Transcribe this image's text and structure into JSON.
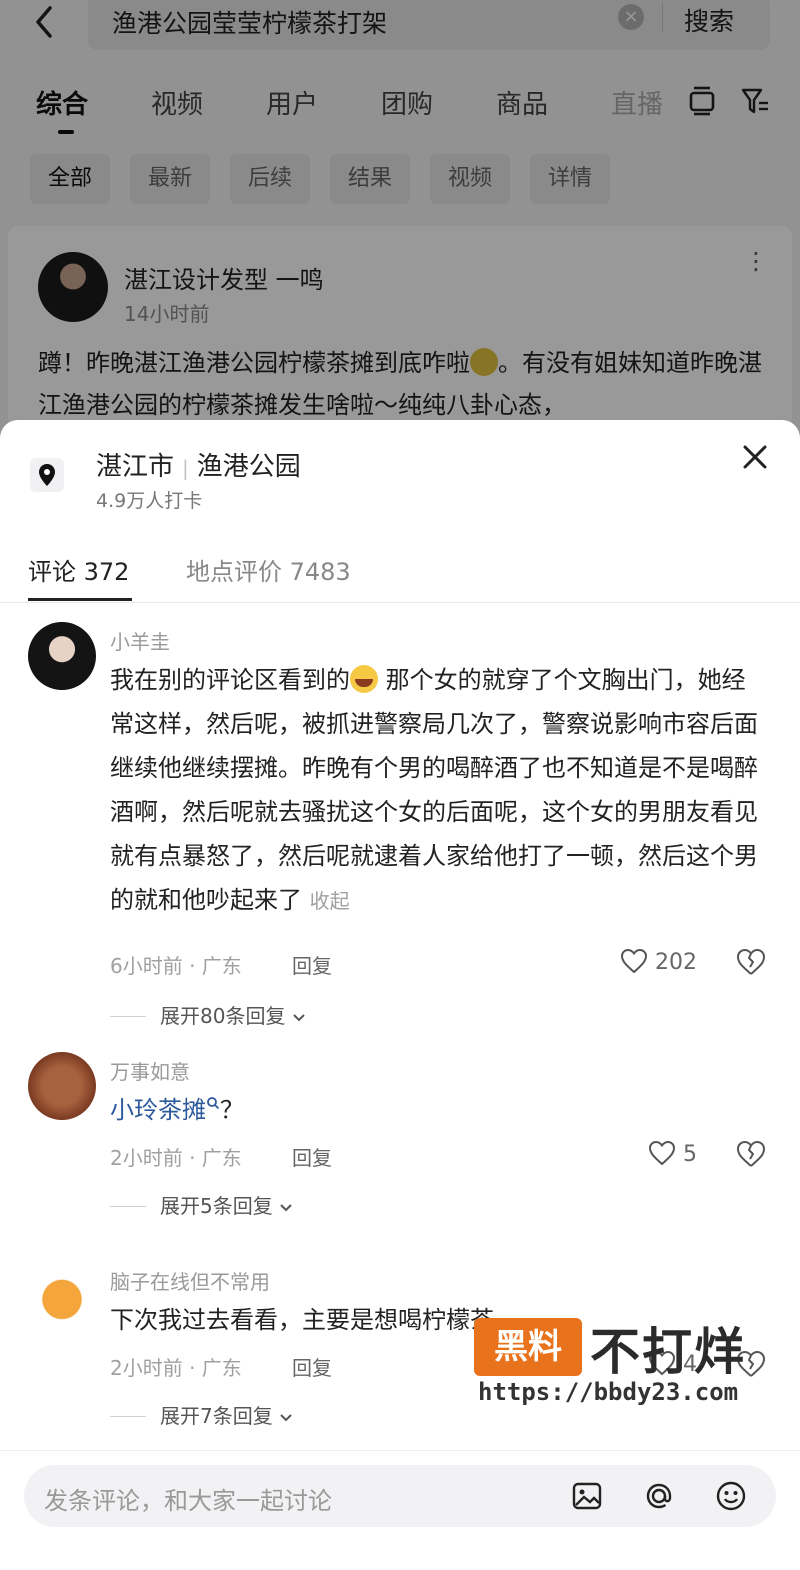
{
  "search": {
    "query": "渔港公园莹莹柠檬茶打架",
    "clear_glyph": "×",
    "button": "搜索"
  },
  "tabs": [
    "综合",
    "视频",
    "用户",
    "团购",
    "商品",
    "直播"
  ],
  "chips": [
    "全部",
    "最新",
    "后续",
    "结果",
    "视频",
    "详情"
  ],
  "post": {
    "author": "湛江设计发型 一鸣",
    "time": "14小时前",
    "text_a": "蹲！昨晚湛江渔港公园柠檬茶摊到底咋啦",
    "text_b": "。有没有姐妹知道昨晚湛江渔港公园的柠檬茶摊发生啥啦～纯纯八卦心态，",
    "more_glyph": "⋮"
  },
  "location": {
    "city": "湛江市",
    "separator": "|",
    "place": "渔港公园",
    "checkins": "4.9万人打卡"
  },
  "sheet_tabs": {
    "comments": "评论 372",
    "reviews": "地点评价 7483"
  },
  "comments": [
    {
      "user": "小羊圭",
      "text_a": "我在别的评论区看到的",
      "text_b": " 那个女的就穿了个文胸出门，她经常这样，然后呢，被抓进警察局几次了，警察说影响市容后面继续他继续摆摊。昨晚有个男的喝醉酒了也不知道是不是喝醉酒啊，然后呢就去骚扰这个女的后面呢，这个女的男朋友看见就有点暴怒了，然后呢就逮着人家给他打了一顿，然后这个男的就和他吵起来了",
      "collapse": "收起",
      "meta": "6小时前 · 广东",
      "reply": "回复",
      "likes": "202",
      "expand": "展开80条回复"
    },
    {
      "user": "万事如意",
      "mention": "小玲茶摊",
      "text_tail": "？",
      "meta": "2小时前 · 广东",
      "reply": "回复",
      "likes": "5",
      "expand": "展开5条回复"
    },
    {
      "user": "脑子在线但不常用",
      "text": "下次我过去看看，主要是想喝柠檬茶",
      "meta": "2小时前 · 广东",
      "reply": "回复",
      "likes": "4",
      "expand": "展开7条回复"
    }
  ],
  "watermark": {
    "box": "黑料",
    "text": "不打烊",
    "url": "https://bbdy23.com"
  },
  "input": {
    "placeholder": "发条评论，和大家一起讨论"
  },
  "icons": [
    "back-icon",
    "clear-icon",
    "box-icon",
    "filter-icon",
    "more-icon",
    "location-pin-icon",
    "close-icon",
    "heart-icon",
    "broken-heart-icon",
    "chevron-down-icon",
    "image-icon",
    "at-icon",
    "emoji-icon"
  ]
}
